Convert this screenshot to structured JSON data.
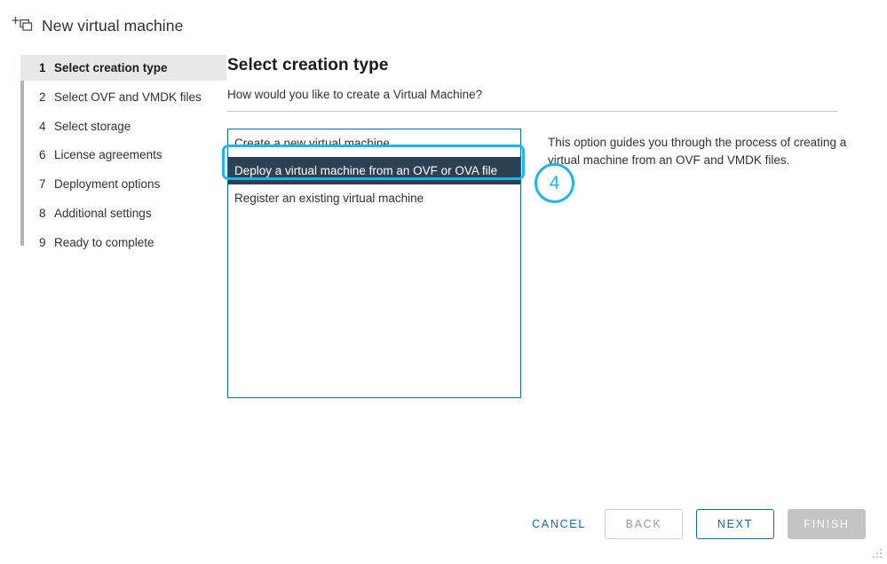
{
  "window": {
    "title": "New virtual machine",
    "icon": "new-virtual-machine-icon"
  },
  "sidebar": {
    "items": [
      {
        "number": "1",
        "label": "Select creation type",
        "active": true
      },
      {
        "number": "2",
        "label": "Select OVF and VMDK files",
        "active": false
      },
      {
        "number": "4",
        "label": "Select storage",
        "active": false
      },
      {
        "number": "6",
        "label": "License agreements",
        "active": false
      },
      {
        "number": "7",
        "label": "Deployment options",
        "active": false
      },
      {
        "number": "8",
        "label": "Additional settings",
        "active": false
      },
      {
        "number": "9",
        "label": "Ready to complete",
        "active": false
      }
    ]
  },
  "main": {
    "title": "Select creation type",
    "subtitle": "How would you like to create a Virtual Machine?",
    "options": [
      {
        "label": "Create a new virtual machine",
        "selected": false
      },
      {
        "label": "Deploy a virtual machine from an OVF or OVA file",
        "selected": true
      },
      {
        "label": "Register an existing virtual machine",
        "selected": false
      }
    ],
    "description": "This option guides you through the process of creating a virtual machine from an OVF and VMDK files."
  },
  "annotations": {
    "step_marker": "4"
  },
  "footer": {
    "cancel_label": "CANCEL",
    "back_label": "BACK",
    "next_label": "NEXT",
    "finish_label": "FINISH"
  },
  "colors": {
    "accent_blue": "#0f6aa8",
    "annotation_cyan": "#1eb4ec",
    "active_step_green": "#318700",
    "selected_row": "#2e4152"
  }
}
